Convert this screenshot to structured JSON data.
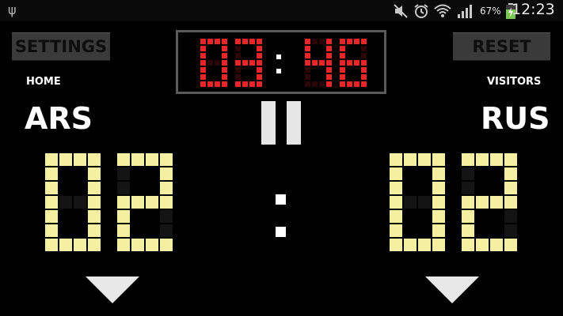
{
  "status_bar": {
    "usb_icon": "usb-icon",
    "icons": [
      "mute-icon",
      "alarm-icon",
      "wifi-icon",
      "signal-icon",
      "battery-charging-icon"
    ],
    "battery_percent": "67%",
    "time": "12:23"
  },
  "buttons": {
    "settings": "SETTINGS",
    "reset": "RESET"
  },
  "clock": {
    "minutes": "03",
    "seconds": "46",
    "separator": ":",
    "color": "#e8262a"
  },
  "home": {
    "label": "HOME",
    "name": "ARS",
    "score": "02"
  },
  "visitors": {
    "label": "VISITORS",
    "name": "RUS",
    "score": "02"
  },
  "score_color": "#f5efa1",
  "pause_icon": "pause-icon",
  "arrows": [
    "decrease-home-arrow-icon",
    "decrease-visitors-arrow-icon"
  ]
}
